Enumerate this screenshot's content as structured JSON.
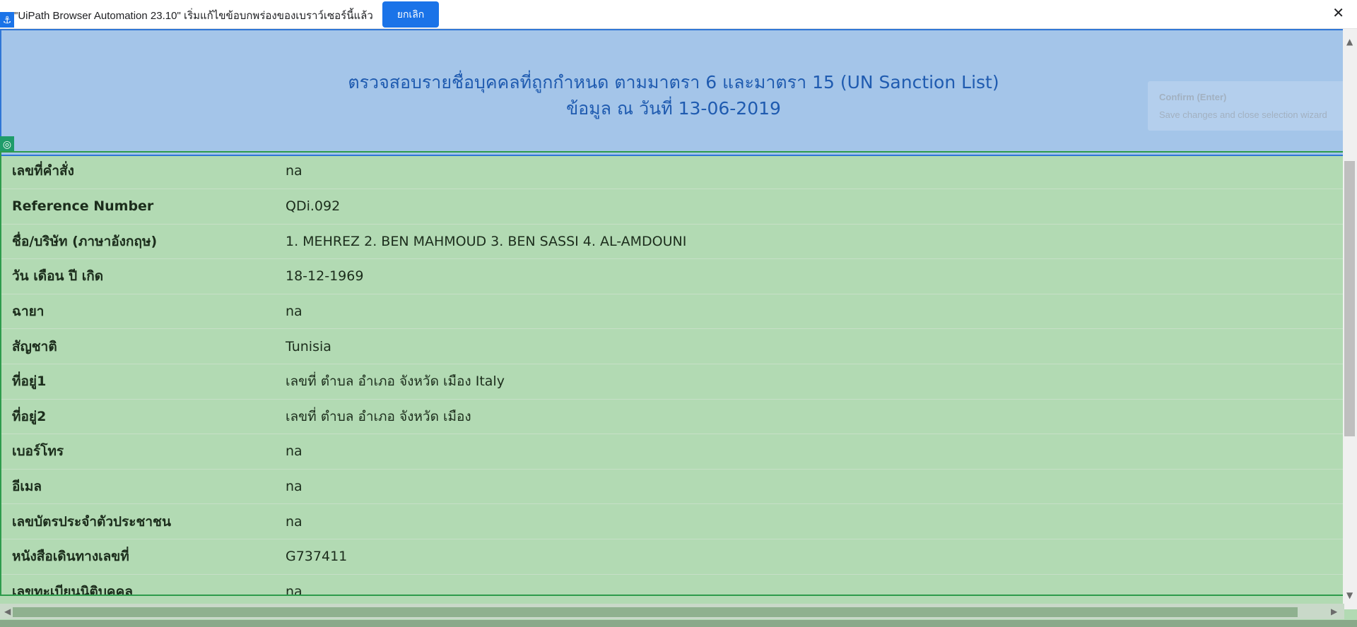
{
  "notification": {
    "message": "\"UiPath Browser Automation 23.10\" เริ่มแก้ไขข้อบกพร่องของเบราว์เซอร์นี้แล้ว",
    "cancel_label": "ยกเลิก",
    "close_glyph": "✕"
  },
  "header": {
    "title_line1": "ตรวจสอบรายชื่อบุคคลที่ถูกกำหนด ตามมาตรา 6 และมาตรา 15 (UN Sanction List)",
    "title_line2": "ข้อมูล ณ วันที่ 13-06-2019"
  },
  "tooltip": {
    "title": "Confirm (Enter)",
    "text": "Save changes and close selection wizard"
  },
  "rows": [
    {
      "label": "เลขที่คำสั่ง",
      "value": "na"
    },
    {
      "label": "Reference Number",
      "value": "QDi.092"
    },
    {
      "label": "ชื่อ/บริษัท (ภาษาอังกฤษ)",
      "value": "1. MEHREZ 2. BEN MAHMOUD 3. BEN SASSI 4. AL-AMDOUNI"
    },
    {
      "label": "วัน เดือน ปี เกิด",
      "value": "18-12-1969"
    },
    {
      "label": "ฉายา",
      "value": "na"
    },
    {
      "label": "สัญชาติ",
      "value": "Tunisia"
    },
    {
      "label": "ที่อยู่1",
      "value": "เลขที่ ตำบล อำเภอ จังหวัด เมือง Italy"
    },
    {
      "label": "ที่อยู่2",
      "value": "เลขที่ ตำบล อำเภอ จังหวัด เมือง"
    },
    {
      "label": "เบอร์โทร",
      "value": "na"
    },
    {
      "label": "อีเมล",
      "value": "na"
    },
    {
      "label": "เลขบัตรประจำตัวประชาชน",
      "value": "na"
    },
    {
      "label": "หนังสือเดินทางเลขที่",
      "value": "G737411"
    },
    {
      "label": "เลขทะเบียนนิติบุคคล",
      "value": "na"
    }
  ],
  "colors": {
    "accent": "#1a73e8",
    "header_band": "#a4c5e9",
    "table_bg": "#b2dab3",
    "selection_green": "#2e9b4c"
  },
  "icons": {
    "anchor": "anchor-icon",
    "target": "target-icon",
    "close": "close-icon"
  }
}
